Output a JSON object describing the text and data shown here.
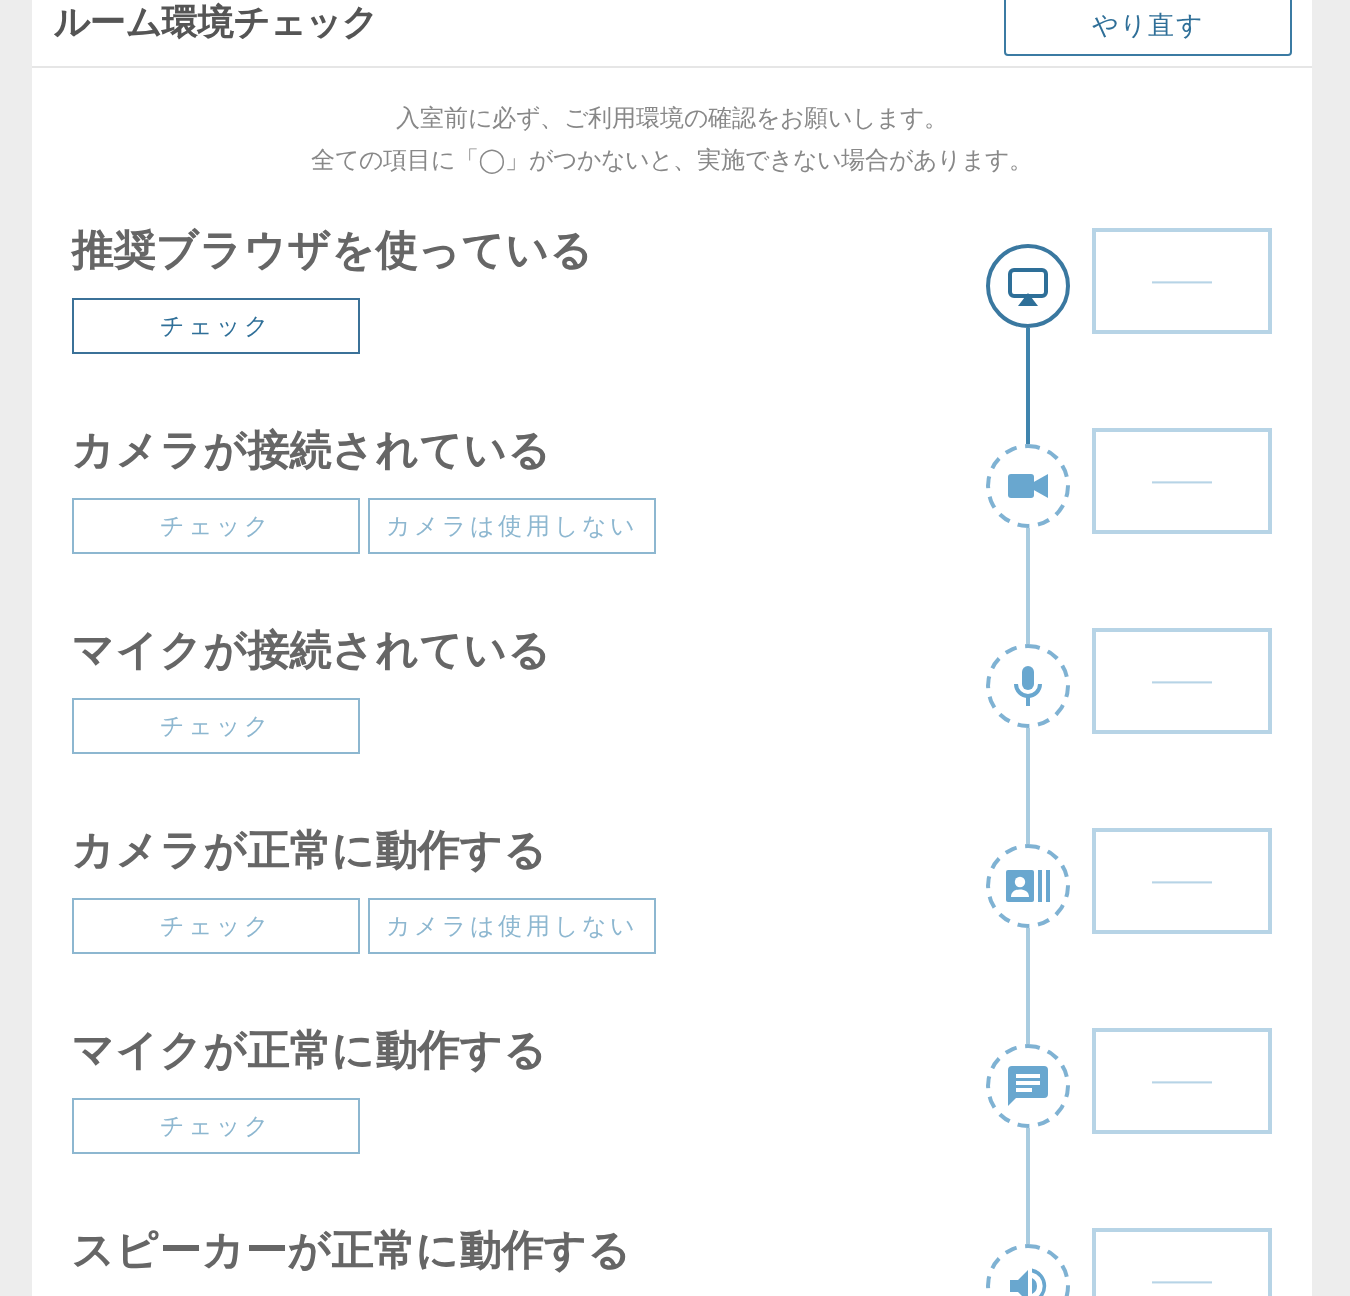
{
  "header": {
    "title": "ルーム環境チェック",
    "redo_button": "やり直す"
  },
  "intro": [
    "入室前に必ず、ご利用環境の確認をお願いします。",
    "全ての項目に「◯」がつかないと、実施できない場合があります。"
  ],
  "steps": [
    {
      "kind": "browser",
      "title": "推奨ブラウザを使っている",
      "active": true,
      "buttons": [
        "チェック"
      ],
      "result": "——"
    },
    {
      "kind": "camera",
      "title": "カメラが接続されている",
      "active": false,
      "buttons": [
        "チェック",
        "カメラは使用しない"
      ],
      "result": "——"
    },
    {
      "kind": "mic",
      "title": "マイクが接続されている",
      "active": false,
      "buttons": [
        "チェック"
      ],
      "result": "——"
    },
    {
      "kind": "camera-test",
      "title": "カメラが正常に動作する",
      "active": false,
      "buttons": [
        "チェック",
        "カメラは使用しない"
      ],
      "result": "——"
    },
    {
      "kind": "mic-test",
      "title": "マイクが正常に動作する",
      "active": false,
      "buttons": [
        "チェック"
      ],
      "result": "——"
    },
    {
      "kind": "speaker",
      "title": "スピーカーが正常に動作する",
      "active": false,
      "result": "——"
    }
  ]
}
